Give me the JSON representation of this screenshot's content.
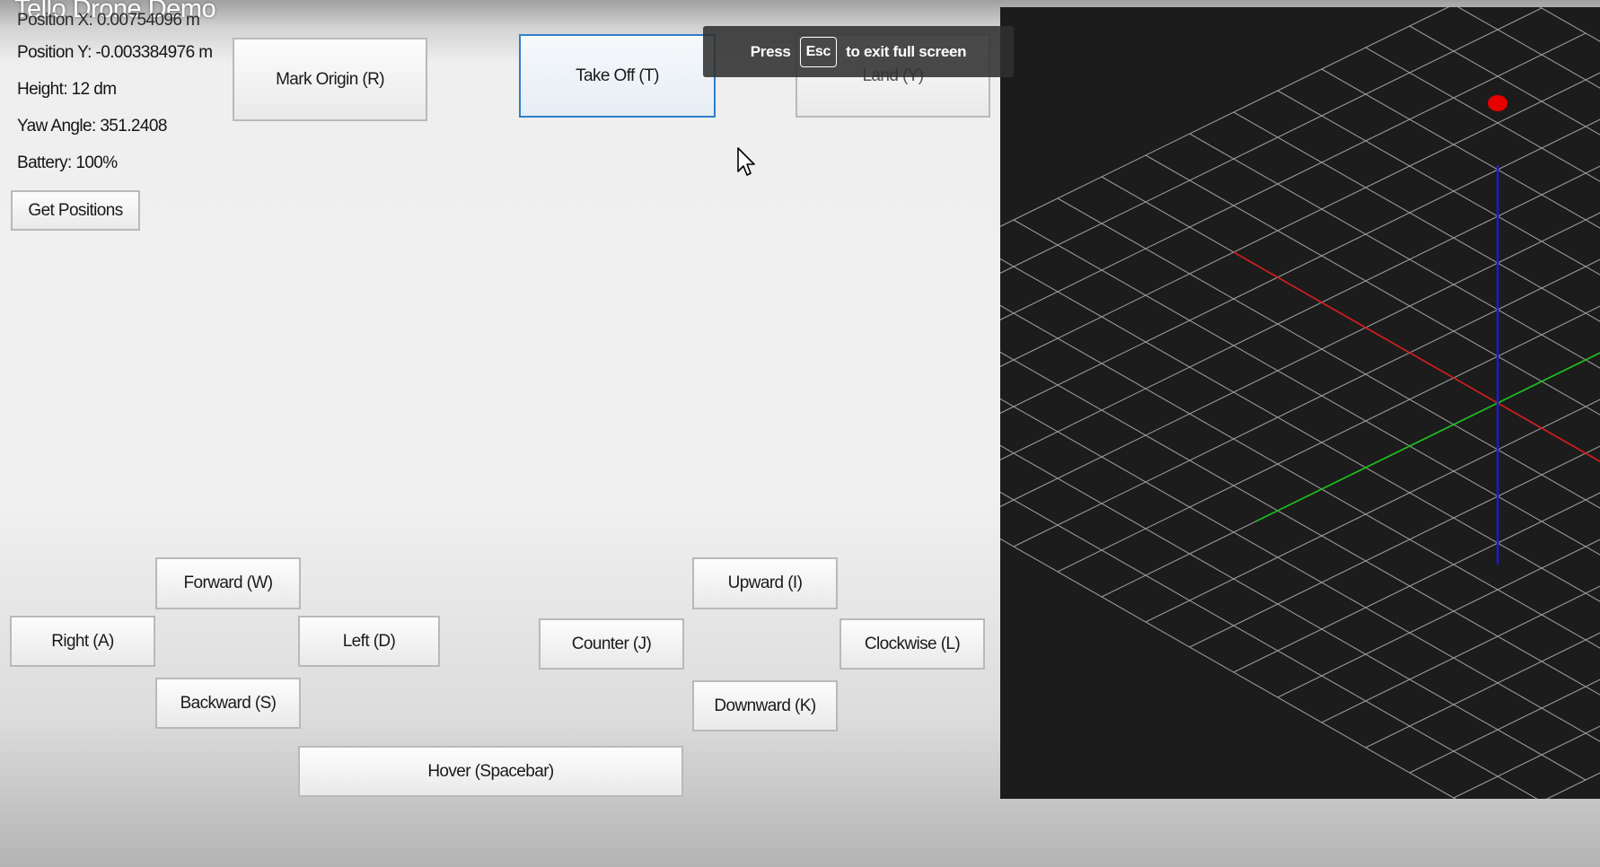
{
  "video": {
    "title": "Tello Drone Demo"
  },
  "telemetry": {
    "position_x": "Position X: 0.00754096 m",
    "position_y": "Position Y: -0.003384976 m",
    "height": "Height: 12 dm",
    "yaw": "Yaw Angle: 351.2408",
    "battery": "Battery: 100%"
  },
  "buttons": {
    "get_positions": "Get Positions",
    "mark_origin": "Mark Origin (R)",
    "take_off": "Take Off (T)",
    "land": "Land (Y)",
    "forward": "Forward (W)",
    "right": "Right (A)",
    "left": "Left (D)",
    "backward": "Backward (S)",
    "upward": "Upward (I)",
    "counter": "Counter (J)",
    "clockwise": "Clockwise (L)",
    "downward": "Downward (K)",
    "hover": "Hover (Spacebar)"
  },
  "fullscreen_toast": {
    "press": "Press",
    "key": "Esc",
    "suffix": "to exit full screen"
  },
  "colors": {
    "viewport_bg": "#1c1c1c",
    "grid": "#9a9a9a",
    "x_axis": "#c81e1e",
    "y_axis": "#1fb91f",
    "z_axis": "#1a1ad2",
    "drone_marker": "#e60000",
    "focus_border": "#2f7fc8"
  }
}
